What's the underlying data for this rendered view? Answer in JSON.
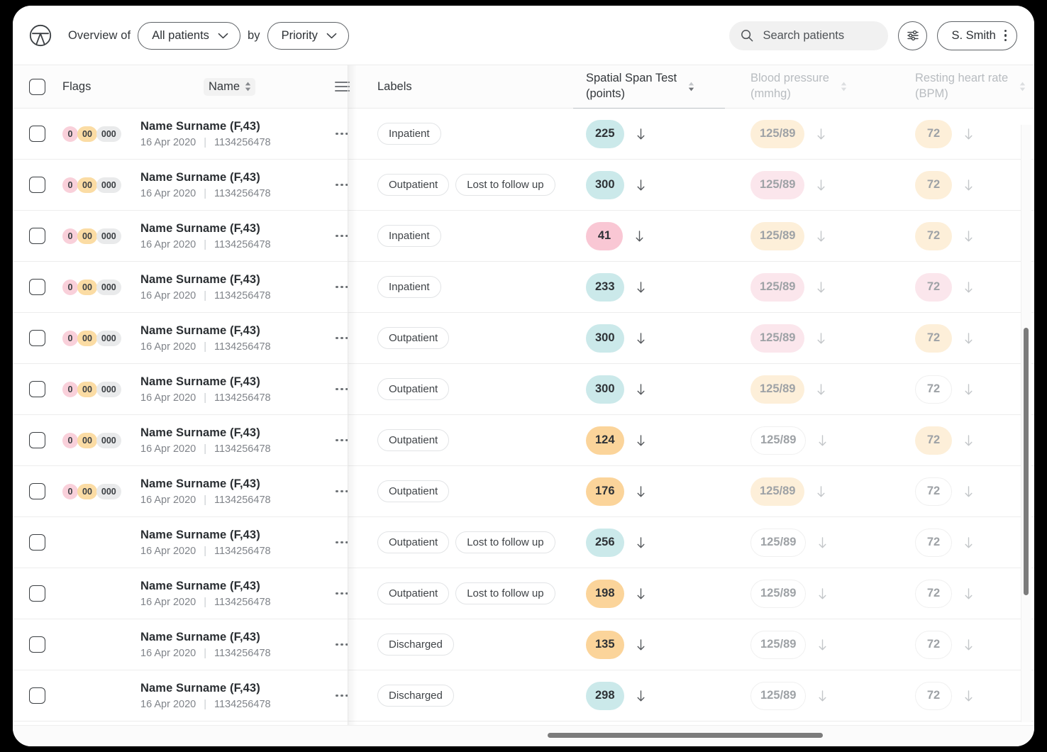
{
  "header": {
    "logo_icon": "patient-logo-icon",
    "overview_prefix": "Overview of",
    "cohort_select": "All patients",
    "by_label": "by",
    "sort_select": "Priority",
    "search_placeholder": "Search patients",
    "filter_icon": "sliders-filter-icon",
    "user_name": "S. Smith",
    "user_menu_icon": "kebab-menu-icon"
  },
  "columns": {
    "flags": "Flags",
    "name": "Name",
    "menu_icon": "hamburger-columns-icon",
    "labels": "Labels",
    "sst_line1": "Spatial Span Test",
    "sst_line2": "(points)",
    "bp_line1": "Blood pressure",
    "bp_line2": "(mmhg)",
    "hr_line1": "Resting heart rate",
    "hr_line2": "(BPM)"
  },
  "colors": {
    "flag_red": "#f9d0da",
    "flag_amber": "#fbdca4",
    "flag_gray": "#e9eaeb",
    "chip_teal": "#cbe9ea",
    "chip_pink": "#f9c7d4",
    "chip_amber": "#fbd49a",
    "faded_amber": "#fdefd9",
    "faded_pink": "#fbe6ec",
    "faded_neutral": "#ffffff",
    "scrollbar": "#7c7c7c",
    "text_primary": "#2a2e32",
    "text_muted": "#80848a"
  },
  "rows": [
    {
      "flags": [
        "0",
        "00",
        "000"
      ],
      "name": "Name Surname (F,43)",
      "date": "16 Apr 2020",
      "id": "1134256478",
      "labels": [
        "Inpatient"
      ],
      "sst": {
        "value": "225",
        "tone": "teal"
      },
      "bp": {
        "value": "125/89",
        "tone": "amber"
      },
      "hr": {
        "value": "72",
        "tone": "amber"
      }
    },
    {
      "flags": [
        "0",
        "00",
        "000"
      ],
      "name": "Name Surname (F,43)",
      "date": "16 Apr 2020",
      "id": "1134256478",
      "labels": [
        "Outpatient",
        "Lost to follow up"
      ],
      "sst": {
        "value": "300",
        "tone": "teal"
      },
      "bp": {
        "value": "125/89",
        "tone": "pink"
      },
      "hr": {
        "value": "72",
        "tone": "amber"
      }
    },
    {
      "flags": [
        "0",
        "00",
        "000"
      ],
      "name": "Name Surname (F,43)",
      "date": "16 Apr 2020",
      "id": "1134256478",
      "labels": [
        "Inpatient"
      ],
      "sst": {
        "value": "41",
        "tone": "pink"
      },
      "bp": {
        "value": "125/89",
        "tone": "amber"
      },
      "hr": {
        "value": "72",
        "tone": "amber"
      }
    },
    {
      "flags": [
        "0",
        "00",
        "000"
      ],
      "name": "Name Surname (F,43)",
      "date": "16 Apr 2020",
      "id": "1134256478",
      "labels": [
        "Inpatient"
      ],
      "sst": {
        "value": "233",
        "tone": "teal"
      },
      "bp": {
        "value": "125/89",
        "tone": "pink"
      },
      "hr": {
        "value": "72",
        "tone": "pink"
      }
    },
    {
      "flags": [
        "0",
        "00",
        "000"
      ],
      "name": "Name Surname (F,43)",
      "date": "16 Apr 2020",
      "id": "1134256478",
      "labels": [
        "Outpatient"
      ],
      "sst": {
        "value": "300",
        "tone": "teal"
      },
      "bp": {
        "value": "125/89",
        "tone": "pink"
      },
      "hr": {
        "value": "72",
        "tone": "amber"
      }
    },
    {
      "flags": [
        "0",
        "00",
        "000"
      ],
      "name": "Name Surname (F,43)",
      "date": "16 Apr 2020",
      "id": "1134256478",
      "labels": [
        "Outpatient"
      ],
      "sst": {
        "value": "300",
        "tone": "teal"
      },
      "bp": {
        "value": "125/89",
        "tone": "amber"
      },
      "hr": {
        "value": "72",
        "tone": "neutral"
      }
    },
    {
      "flags": [
        "0",
        "00",
        "000"
      ],
      "name": "Name Surname (F,43)",
      "date": "16 Apr 2020",
      "id": "1134256478",
      "labels": [
        "Outpatient"
      ],
      "sst": {
        "value": "124",
        "tone": "amber"
      },
      "bp": {
        "value": "125/89",
        "tone": "neutral"
      },
      "hr": {
        "value": "72",
        "tone": "amber"
      }
    },
    {
      "flags": [
        "0",
        "00",
        "000"
      ],
      "name": "Name Surname (F,43)",
      "date": "16 Apr 2020",
      "id": "1134256478",
      "labels": [
        "Outpatient"
      ],
      "sst": {
        "value": "176",
        "tone": "amber"
      },
      "bp": {
        "value": "125/89",
        "tone": "amber"
      },
      "hr": {
        "value": "72",
        "tone": "neutral"
      }
    },
    {
      "flags": [],
      "name": "Name Surname (F,43)",
      "date": "16 Apr 2020",
      "id": "1134256478",
      "labels": [
        "Outpatient",
        "Lost to follow up"
      ],
      "sst": {
        "value": "256",
        "tone": "teal"
      },
      "bp": {
        "value": "125/89",
        "tone": "neutral"
      },
      "hr": {
        "value": "72",
        "tone": "neutral"
      }
    },
    {
      "flags": [],
      "name": "Name Surname (F,43)",
      "date": "16 Apr 2020",
      "id": "1134256478",
      "labels": [
        "Outpatient",
        "Lost to follow up"
      ],
      "sst": {
        "value": "198",
        "tone": "amber"
      },
      "bp": {
        "value": "125/89",
        "tone": "neutral"
      },
      "hr": {
        "value": "72",
        "tone": "neutral"
      }
    },
    {
      "flags": [],
      "name": "Name Surname (F,43)",
      "date": "16 Apr 2020",
      "id": "1134256478",
      "labels": [
        "Discharged"
      ],
      "sst": {
        "value": "135",
        "tone": "amber"
      },
      "bp": {
        "value": "125/89",
        "tone": "neutral"
      },
      "hr": {
        "value": "72",
        "tone": "neutral"
      }
    },
    {
      "flags": [],
      "name": "Name Surname (F,43)",
      "date": "16 Apr 2020",
      "id": "1134256478",
      "labels": [
        "Discharged"
      ],
      "sst": {
        "value": "298",
        "tone": "teal"
      },
      "bp": {
        "value": "125/89",
        "tone": "neutral"
      },
      "hr": {
        "value": "72",
        "tone": "neutral"
      }
    }
  ]
}
